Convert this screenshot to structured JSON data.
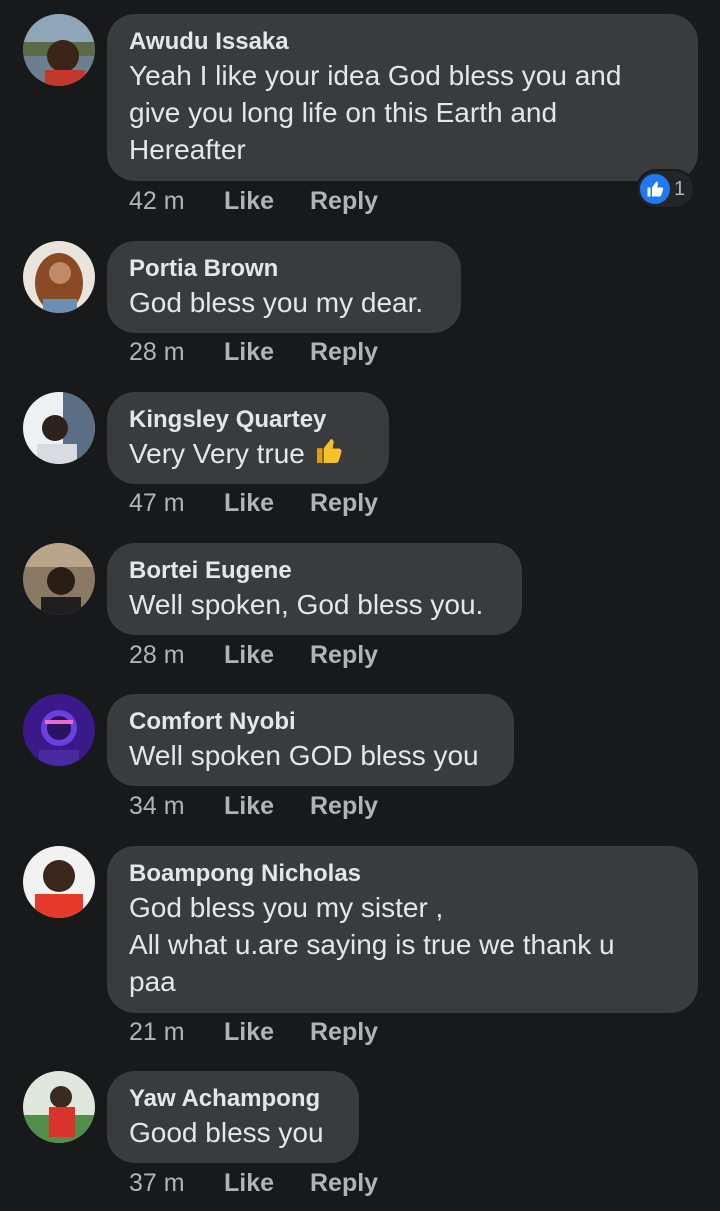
{
  "comments": [
    {
      "author": "Awudu Issaka",
      "text": "Yeah I like your idea God bless you and\ngive you long life on this Earth and\nHereafter",
      "time": "42 m",
      "like_label": "Like",
      "reply_label": "Reply",
      "reaction_count": "1",
      "reaction_icon": "thumbs-up-icon"
    },
    {
      "author": "Portia Brown",
      "text": "God bless you my dear.",
      "time": "28 m",
      "like_label": "Like",
      "reply_label": "Reply"
    },
    {
      "author": "Kingsley Quartey",
      "text": "Very  Very true",
      "emoji": "thumbs-up-emoji",
      "time": "47 m",
      "like_label": "Like",
      "reply_label": "Reply"
    },
    {
      "author": "Bortei Eugene",
      "text": "Well spoken, God bless you.",
      "time": "28 m",
      "like_label": "Like",
      "reply_label": "Reply"
    },
    {
      "author": "Comfort Nyobi",
      "text": "Well spoken GOD bless you",
      "time": "34 m",
      "like_label": "Like",
      "reply_label": "Reply"
    },
    {
      "author": "Boampong Nicholas",
      "text": "God bless you my sister ,\nAll what u.are saying is true we thank u\npaa",
      "time": "21 m",
      "like_label": "Like",
      "reply_label": "Reply"
    },
    {
      "author": "Yaw Achampong",
      "text": "Good bless you",
      "time": "37 m",
      "like_label": "Like",
      "reply_label": "Reply"
    }
  ],
  "colors": {
    "background": "#18191a",
    "bubble": "#3a3b3c",
    "text": "#e4e6eb",
    "meta": "#b0b3b8",
    "like_blue": "#2078f4"
  }
}
